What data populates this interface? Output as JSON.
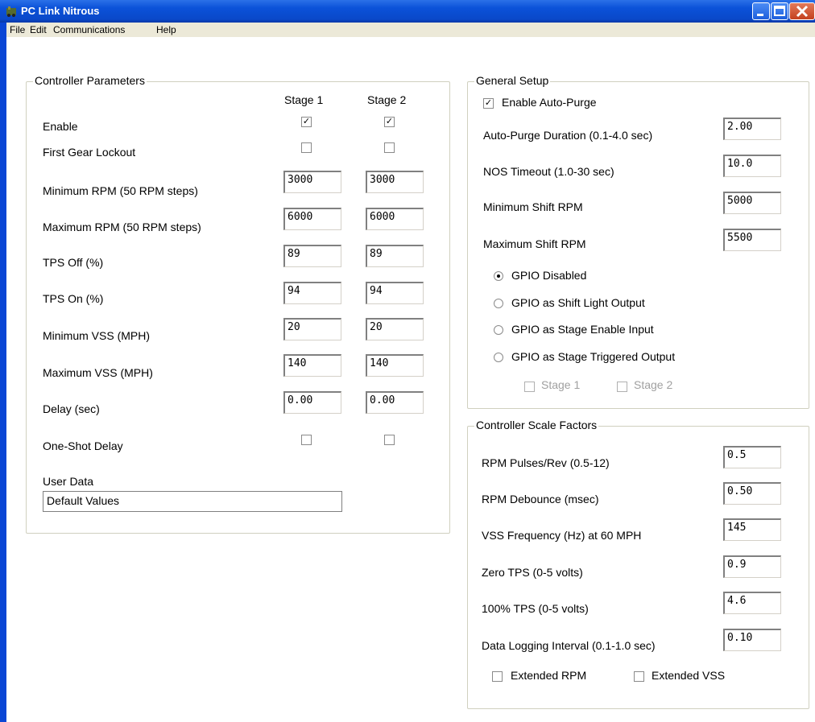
{
  "window": {
    "title": "PC Link Nitrous"
  },
  "menu": [
    "File",
    "Edit",
    "Communications",
    "Help"
  ],
  "controller": {
    "title": "Controller Parameters",
    "stage1_header": "Stage 1",
    "stage2_header": "Stage 2",
    "enable_label": "Enable",
    "enable": {
      "stage1": true,
      "stage2": true
    },
    "first_gear_label": "First Gear Lockout",
    "first_gear": {
      "stage1": false,
      "stage2": false
    },
    "fields": [
      {
        "label": "Minimum RPM (50 RPM steps)",
        "stage1": "3000",
        "stage2": "3000"
      },
      {
        "label": "Maximum RPM (50 RPM steps)",
        "stage1": "6000",
        "stage2": "6000"
      },
      {
        "label": "TPS Off (%)",
        "stage1": "89",
        "stage2": "89"
      },
      {
        "label": "TPS On (%)",
        "stage1": "94",
        "stage2": "94"
      },
      {
        "label": "Minimum VSS (MPH)",
        "stage1": "20",
        "stage2": "20"
      },
      {
        "label": "Maximum VSS (MPH)",
        "stage1": "140",
        "stage2": "140"
      },
      {
        "label": "Delay (sec)",
        "stage1": "0.00",
        "stage2": "0.00"
      }
    ],
    "one_shot_label": "One-Shot Delay",
    "one_shot": {
      "stage1": false,
      "stage2": false
    },
    "user_data_label": "User Data",
    "user_data_value": "Default Values"
  },
  "general": {
    "title": "General Setup",
    "auto_purge_label": "Enable Auto-Purge",
    "auto_purge": true,
    "fields": [
      {
        "label": "Auto-Purge Duration (0.1-4.0 sec)",
        "value": "2.00"
      },
      {
        "label": "NOS Timeout (1.0-30 sec)",
        "value": "10.0"
      },
      {
        "label": "Minimum Shift RPM",
        "value": "5000"
      },
      {
        "label": "Maximum Shift RPM",
        "value": "5500"
      }
    ],
    "gpio_options": [
      {
        "label": "GPIO Disabled",
        "selected": true
      },
      {
        "label": "GPIO as Shift Light Output",
        "selected": false
      },
      {
        "label": "GPIO as Stage Enable Input",
        "selected": false
      },
      {
        "label": "GPIO as Stage Triggered Output",
        "selected": false
      }
    ],
    "stage1_label": "Stage 1",
    "stage2_label": "Stage 2"
  },
  "scale": {
    "title": "Controller Scale Factors",
    "fields": [
      {
        "label": "RPM Pulses/Rev (0.5-12)",
        "value": "0.5"
      },
      {
        "label": "RPM Debounce (msec)",
        "value": "0.50"
      },
      {
        "label": "VSS Frequency (Hz)  at 60 MPH",
        "value": "145"
      },
      {
        "label": "Zero TPS (0-5 volts)",
        "value": "0.9"
      },
      {
        "label": "100% TPS (0-5 volts)",
        "value": "4.6"
      },
      {
        "label": "Data Logging Interval (0.1-1.0 sec)",
        "value": "0.10"
      }
    ],
    "extended_rpm_label": "Extended RPM",
    "extended_vss_label": "Extended VSS",
    "extended_rpm": false,
    "extended_vss": false
  }
}
